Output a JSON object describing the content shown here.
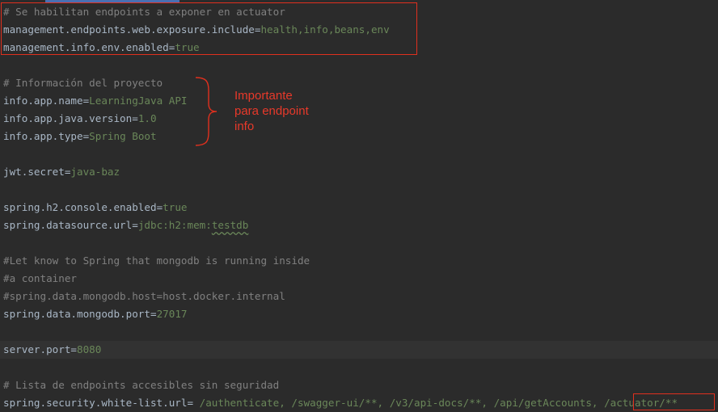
{
  "editor": {
    "current_line_highlight": true,
    "lines": [
      {
        "type": "comment",
        "text": "# Se habilitan endpoints a exponer en actuator"
      },
      {
        "type": "prop",
        "key": "management.endpoints.web.exposure.include",
        "value": "health,info,beans,env"
      },
      {
        "type": "prop",
        "key": "management.info.env.enabled",
        "value": "true"
      },
      {
        "type": "blank"
      },
      {
        "type": "comment",
        "text": "# Información del proyecto"
      },
      {
        "type": "prop",
        "key": "info.app.name",
        "value": "LearningJava API"
      },
      {
        "type": "prop",
        "key": "info.app.java.version",
        "value": "1.0"
      },
      {
        "type": "prop",
        "key": "info.app.type",
        "value": "Spring Boot"
      },
      {
        "type": "blank"
      },
      {
        "type": "prop",
        "key": "jwt.secret",
        "value": "java-baz"
      },
      {
        "type": "blank"
      },
      {
        "type": "prop",
        "key": "spring.h2.console.enabled",
        "value": "true"
      },
      {
        "type": "prop",
        "key": "spring.datasource.url",
        "value": "jdbc:h2:mem:",
        "value_squiggle": "testdb"
      },
      {
        "type": "blank"
      },
      {
        "type": "comment",
        "text": "#Let know to Spring that mongodb is running inside"
      },
      {
        "type": "comment",
        "text": "#a container"
      },
      {
        "type": "comment",
        "text": "#spring.data.mongodb.host=host.docker.internal"
      },
      {
        "type": "prop",
        "key": "spring.data.mongodb.port",
        "value": "27017"
      },
      {
        "type": "blank"
      },
      {
        "type": "prop",
        "key": "server.port",
        "value": "8080",
        "current": true
      },
      {
        "type": "blank"
      },
      {
        "type": "comment",
        "text": "# Lista de endpoints accesibles sin seguridad"
      },
      {
        "type": "prop",
        "key": "spring.security.white-list.url",
        "value": " /authenticate, /swagger-ui/**, /v3/api-docs/**, /api/getAccounts, ",
        "value_boxed": "/actuator/**"
      }
    ]
  },
  "annotation": {
    "lines": [
      "Importante",
      "para endpoint",
      "info"
    ],
    "color": "#e8392a"
  },
  "colors": {
    "background": "#2b2b2b",
    "comment": "#808080",
    "key": "#a9b7c6",
    "value": "#6a8759",
    "annotation_red": "#e0301e"
  }
}
